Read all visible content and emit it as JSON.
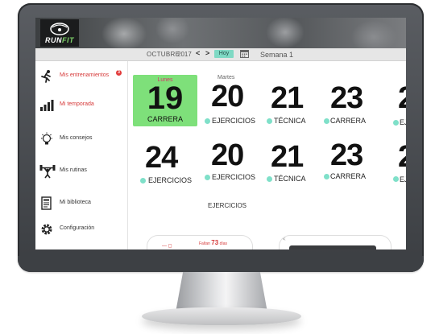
{
  "app": {
    "logo_run": "RUN",
    "logo_fit": "FIT"
  },
  "datebar": {
    "month": "OCTUBRE",
    "year": "2017",
    "prev": "<",
    "next": ">",
    "today_label": "Hoy",
    "week_label": "Semana 1"
  },
  "sidebar": {
    "items": [
      {
        "label": "Mis entrenamientos",
        "icon": "runner-icon",
        "badge": "3"
      },
      {
        "label": "Mi temporada",
        "icon": "bar-chart-icon"
      },
      {
        "label": "Mis consejos",
        "icon": "lightbulb-icon"
      },
      {
        "label": "Mis rutinas",
        "icon": "weightlifter-icon"
      },
      {
        "label": "Mi biblioteca",
        "icon": "book-icon"
      },
      {
        "label": "Configuración",
        "icon": "gear-icon"
      }
    ]
  },
  "calendar": {
    "today": {
      "name": "Lunes",
      "number": "19",
      "type": "CARRERA"
    },
    "row1": [
      {
        "name": "Martes",
        "number": "20",
        "type": "EJERCICIOS"
      },
      {
        "name": "",
        "number": "21",
        "type": "TÉCNICA"
      },
      {
        "name": "",
        "number": "23",
        "type": "CARRERA"
      },
      {
        "name": "",
        "number": "2",
        "type": "EJ"
      }
    ],
    "row2": [
      {
        "name": "",
        "number": "24",
        "type": "EJERCICIOS"
      },
      {
        "name": "",
        "number": "20",
        "type": "EJERCICIOS"
      },
      {
        "name": "",
        "number": "21",
        "type": "TÉCNICA"
      },
      {
        "name": "",
        "number": "23",
        "type": "CARRERA"
      },
      {
        "name": "",
        "number": "2",
        "type": "EJ"
      }
    ],
    "extra_label": "EJERCICIOS"
  },
  "widgets": {
    "falta_prefix": "Faltan",
    "falta_days": "73",
    "falta_suffix": "días",
    "mini": "— ◻",
    "arrow": "<"
  },
  "colors": {
    "today_bg": "#7ee07a",
    "dot": "#7fe0c9",
    "accent_red": "#d63a3a",
    "today_btn": "#7fd9c4"
  }
}
